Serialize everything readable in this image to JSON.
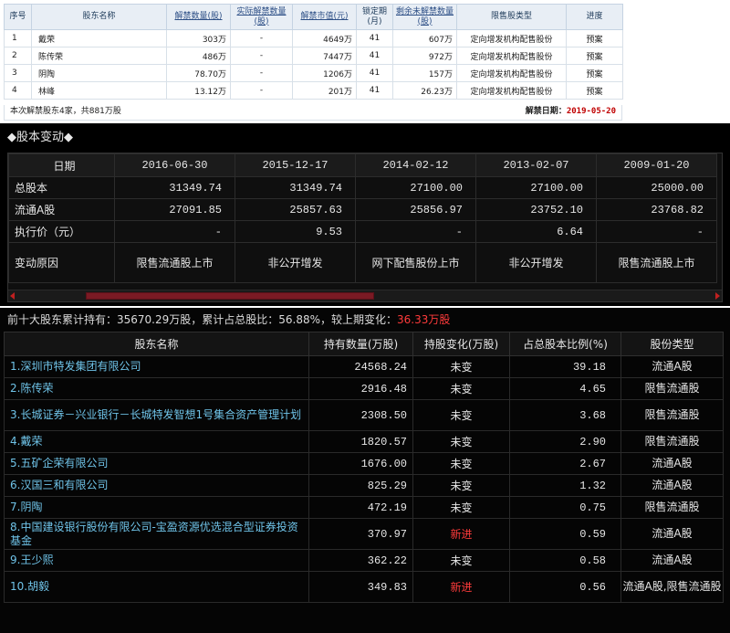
{
  "unlock_table": {
    "headers": [
      "序号",
      "股东名称",
      "解禁数量(股)",
      "实际解禁数量(股)",
      "解禁市值(元)",
      "锁定期(月)",
      "剩余未解禁数量(股)",
      "限售股类型",
      "进度"
    ],
    "rows": [
      [
        "1",
        "戴荣",
        "303万",
        "-",
        "4649万",
        "41",
        "607万",
        "定向增发机构配售股份",
        "预案"
      ],
      [
        "2",
        "陈传荣",
        "486万",
        "-",
        "7447万",
        "41",
        "972万",
        "定向增发机构配售股份",
        "预案"
      ],
      [
        "3",
        "阴陶",
        "78.70万",
        "-",
        "1206万",
        "41",
        "157万",
        "定向增发机构配售股份",
        "预案"
      ],
      [
        "4",
        "林峰",
        "13.12万",
        "-",
        "201万",
        "41",
        "26.23万",
        "定向增发机构配售股份",
        "预案"
      ]
    ],
    "footer_left": "本次解禁股东4家，共881万股",
    "footer_date_label": "解禁日期：",
    "footer_date": "2019-05-20"
  },
  "capital_change": {
    "title": "◆股本变动◆",
    "headers": [
      "日期",
      "2016-06-30",
      "2015-12-17",
      "2014-02-12",
      "2013-02-07",
      "2009-01-20"
    ],
    "rows": [
      [
        "总股本",
        "31349.74",
        "31349.74",
        "27100.00",
        "27100.00",
        "25000.00"
      ],
      [
        "流通A股",
        "27091.85",
        "25857.63",
        "25856.97",
        "23752.10",
        "23768.82"
      ],
      [
        "执行价（元）",
        "-",
        "9.53",
        "-",
        "6.64",
        "-"
      ]
    ],
    "reason_label": "变动原因",
    "reasons": [
      "限售流通股上市",
      "非公开增发",
      "网下配售股份上市",
      "非公开增发",
      "限售流通股上市"
    ],
    "scroll_position": 0.17
  },
  "top_holders": {
    "summary_prefix": "前十大股东累计持有：35670.29万股，累计占总股比：56.88%，较上期变化：",
    "summary_change": "36.33万股",
    "headers": [
      "股东名称",
      "持有数量(万股)",
      "持股变化(万股)",
      "占总股本比例(%)",
      "股份类型"
    ],
    "rows": [
      {
        "name": "1.深圳市特发集团有限公司",
        "qty": "24568.24",
        "change": "未变",
        "pct": "39.18",
        "type": "流通A股"
      },
      {
        "name": "2.陈传荣",
        "qty": "2916.48",
        "change": "未变",
        "pct": "4.65",
        "type": "限售流通股"
      },
      {
        "name": "3.长城证券－兴业银行－长城特发智想1号集合资产管理计划",
        "qty": "2308.50",
        "change": "未变",
        "pct": "3.68",
        "type": "限售流通股"
      },
      {
        "name": "4.戴荣",
        "qty": "1820.57",
        "change": "未变",
        "pct": "2.90",
        "type": "限售流通股"
      },
      {
        "name": "5.五矿企荣有限公司",
        "qty": "1676.00",
        "change": "未变",
        "pct": "2.67",
        "type": "流通A股"
      },
      {
        "name": "6.汉国三和有限公司",
        "qty": "825.29",
        "change": "未变",
        "pct": "1.32",
        "type": "流通A股"
      },
      {
        "name": "7.阴陶",
        "qty": "472.19",
        "change": "未变",
        "pct": "0.75",
        "type": "限售流通股"
      },
      {
        "name": "8.中国建设银行股份有限公司-宝盈资源优选混合型证券投资基金",
        "qty": "370.97",
        "change": "新进",
        "pct": "0.59",
        "type": "流通A股"
      },
      {
        "name": "9.王少熙",
        "qty": "362.22",
        "change": "未变",
        "pct": "0.58",
        "type": "流通A股"
      },
      {
        "name": "10.胡毅",
        "qty": "349.83",
        "change": "新进",
        "pct": "0.56",
        "type": "流通A股,限售流通股"
      }
    ]
  },
  "colors": {
    "dark_bg": "#000000",
    "link_blue": "#6fc3e8",
    "highlight_red": "#ff3b3b",
    "date_red": "#c00000"
  }
}
